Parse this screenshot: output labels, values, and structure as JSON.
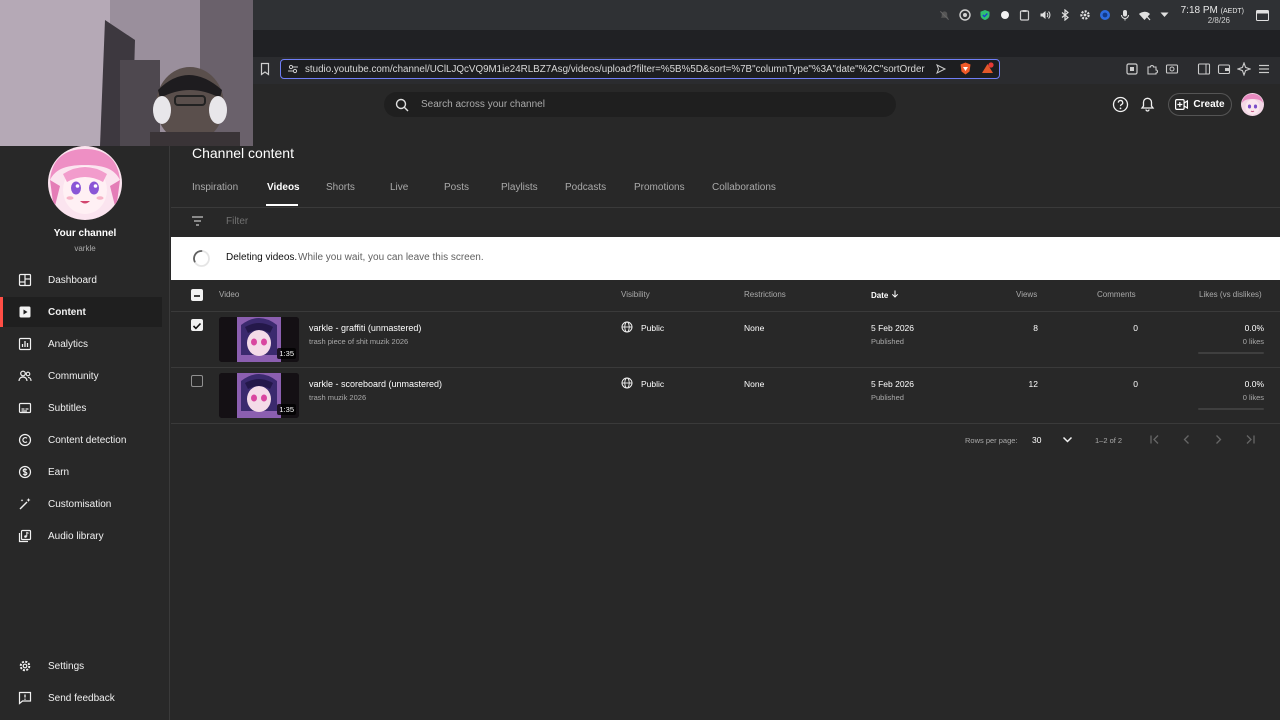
{
  "os": {
    "clock_time": "7:18 PM",
    "clock_tz": "(AEDT)",
    "clock_date": "2/8/26",
    "tray_icons": [
      "bell-off-icon",
      "vpn-icon",
      "shield-icon",
      "dot-icon",
      "clipboard-icon",
      "volume-icon",
      "bluetooth-icon",
      "settings-icon",
      "globe-icon",
      "mic-icon",
      "wifi-icon",
      "chevron-down-icon",
      "window-icon"
    ]
  },
  "browser": {
    "url": "studio.youtube.com/channel/UClLJQcVQ9M1ie24RLBZ7Asg/videos/upload?filter=%5B%5D&sort=%7B\"columnType\"%3A\"date\"%2C\"sortOrder"
  },
  "header": {
    "search_placeholder": "Search across your channel",
    "create_label": "Create"
  },
  "sidebar": {
    "channel_title": "Your channel",
    "channel_handle": "varkle",
    "nav": [
      {
        "label": "Dashboard",
        "icon": "dashboard-icon"
      },
      {
        "label": "Content",
        "icon": "content-icon"
      },
      {
        "label": "Analytics",
        "icon": "analytics-icon"
      },
      {
        "label": "Community",
        "icon": "community-icon"
      },
      {
        "label": "Subtitles",
        "icon": "subtitles-icon"
      },
      {
        "label": "Content detection",
        "icon": "copyright-icon"
      },
      {
        "label": "Earn",
        "icon": "dollar-icon"
      },
      {
        "label": "Customisation",
        "icon": "magic-wand-icon"
      },
      {
        "label": "Audio library",
        "icon": "audio-library-icon"
      }
    ],
    "settings_label": "Settings",
    "feedback_label": "Send feedback"
  },
  "main": {
    "title": "Channel content",
    "tabs": [
      "Inspiration",
      "Videos",
      "Shorts",
      "Live",
      "Posts",
      "Playlists",
      "Podcasts",
      "Promotions",
      "Collaborations"
    ],
    "active_tab": "Videos",
    "filter_placeholder": "Filter",
    "banner_bold": "Deleting videos.",
    "banner_text": "While you wait, you can leave this screen.",
    "columns": {
      "video": "Video",
      "visibility": "Visibility",
      "restrictions": "Restrictions",
      "date": "Date",
      "views": "Views",
      "comments": "Comments",
      "likes": "Likes (vs dislikes)"
    },
    "rows": [
      {
        "checked": true,
        "title": "varkle - graffiti (unmastered)",
        "description": "trash piece of shit muzik 2026",
        "duration": "1:35",
        "visibility": "Public",
        "restrictions": "None",
        "date": "5 Feb 2026",
        "status": "Published",
        "views": "8",
        "comments": "0",
        "likes_pct": "0.0%",
        "likes_count": "0 likes"
      },
      {
        "checked": false,
        "title": "varkle - scoreboard (unmastered)",
        "description": "trash muzik 2026",
        "duration": "1:35",
        "visibility": "Public",
        "restrictions": "None",
        "date": "5 Feb 2026",
        "status": "Published",
        "views": "12",
        "comments": "0",
        "likes_pct": "0.0%",
        "likes_count": "0 likes"
      }
    ],
    "pagination": {
      "rows_per_page_label": "Rows per page:",
      "rows_per_page": "30",
      "range": "1–2 of 2"
    }
  },
  "colors": {
    "background": "#282828",
    "accent_red": "#ff4e45",
    "url_focus": "#6f7ef5",
    "banner_bg": "#ffffff"
  }
}
